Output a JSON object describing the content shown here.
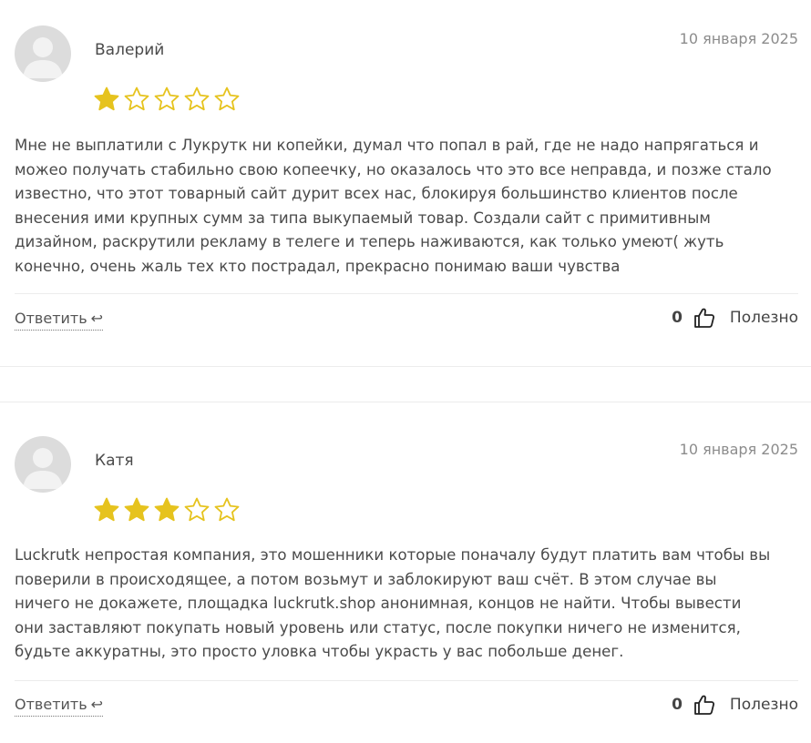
{
  "reviews": [
    {
      "author": "Валерий",
      "date": "10 января 2025",
      "rating": 1,
      "max_rating": 5,
      "lines": [
        "Мне не выплатили с Лукрутк ни копейки, думал что попал в рай, где не надо напрягаться и",
        "можео получать стабильно свою копеечку, но оказалось что это все неправда, и позже стало",
        "известно, что этот товарный сайт дурит всех нас, блокируя большинство клиентов после",
        "внесения ими крупных сумм за типа выкупаемый товар. Создали сайт с примитивным",
        "дизайном, раскрутили рекламу в телеге и теперь наживаются, как только умеют( жуть",
        "конечно, очень жаль тех кто пострадал, прекрасно понимаю ваши чувства"
      ],
      "reply_label": "Ответить",
      "reply_icon": "reply-arrow-icon",
      "useful_count": "0",
      "useful_label": "Полезно"
    },
    {
      "author": "Катя",
      "date": "10 января 2025",
      "rating": 3,
      "max_rating": 5,
      "lines": [
        "Luckrutk непростая компания, это мошенники которые поначалу будут платить вам чтобы вы",
        "поверили в происходящее, а потом возьмут и заблокируют ваш счёт. В этом случае вы",
        "ничего не докажете, площадка luckrutk.shop анонимная, концов не найти. Чтобы вывести",
        "они заставляют покупать новый уровень или статус, после покупки ничего не изменится,",
        "будьте аккуратны, это просто уловка чтобы украсть у вас побольше денег."
      ],
      "reply_label": "Ответить",
      "reply_icon": "reply-arrow-icon",
      "useful_count": "0",
      "useful_label": "Полезно"
    }
  ],
  "colors": {
    "star_filled": "#e6c31e",
    "star_empty_stroke": "#e6c31e",
    "avatar_bg": "#dcdcdc"
  }
}
